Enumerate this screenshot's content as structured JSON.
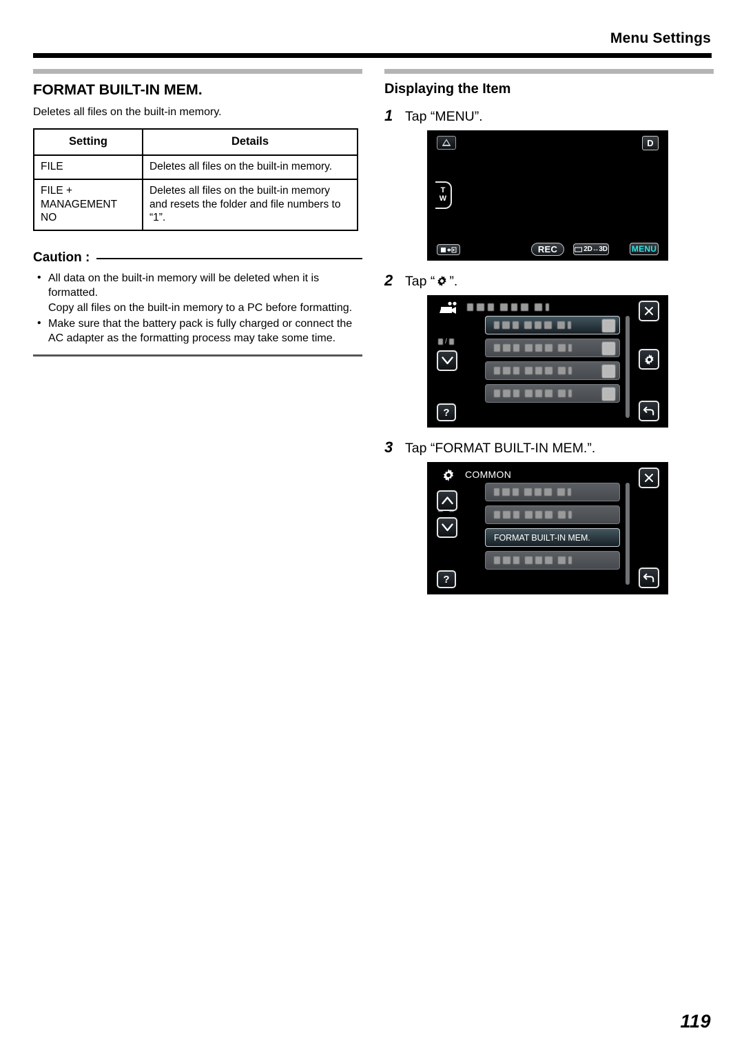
{
  "header": {
    "title": "Menu Settings"
  },
  "left_column": {
    "section_title": "FORMAT BUILT-IN MEM.",
    "lead": "Deletes all files on the built-in memory.",
    "table": {
      "headers": [
        "Setting",
        "Details"
      ],
      "rows": [
        [
          "FILE",
          "Deletes all files on the built-in memory."
        ],
        [
          "FILE + MANAGEMENT NO",
          "Deletes all files on the built-in memory and resets the folder and file numbers to “1”."
        ]
      ]
    },
    "caution": {
      "label": "Caution :",
      "items": [
        "All data on the built-in memory will be deleted when it is formatted.\nCopy all files on the built-in memory to a PC before formatting.",
        "Make sure that the battery pack is fully charged or connect the AC adapter as the formatting process may take some time."
      ]
    }
  },
  "right_column": {
    "section_title": "Displaying the Item",
    "steps": [
      {
        "number": "1",
        "text_before": "Tap “MENU”.",
        "text_after": ""
      },
      {
        "number": "2",
        "text_before": "Tap “",
        "text_after": "”."
      },
      {
        "number": "3",
        "text_before": "Tap “FORMAT BUILT-IN MEM.”.",
        "text_after": ""
      }
    ],
    "screen_rec": {
      "icons": {
        "tripod": "tripod-icon",
        "d_badge": "D",
        "zoom_top": "T",
        "zoom_bottom": "W",
        "playmode": "play-record-switch-icon",
        "rec": "REC",
        "mode_2d3d": "2D↔3D",
        "menu": "MENU"
      },
      "menu_button_color": "#29e6e6"
    },
    "screen_menu_1": {
      "top_icon": "camcorder-icon",
      "title_redacted": true,
      "page_indicator": "■/■",
      "rows": [
        {
          "label": "",
          "redacted": true,
          "selected": true,
          "thumb": true
        },
        {
          "label": "",
          "redacted": true,
          "selected": false,
          "thumb": true
        },
        {
          "label": "",
          "redacted": true,
          "selected": false,
          "thumb": true
        },
        {
          "label": "",
          "redacted": true,
          "selected": false,
          "thumb": true
        }
      ],
      "buttons": {
        "close": "✕",
        "gear": "gear-icon",
        "back": "back-arrow-icon",
        "down": "∨",
        "help": "?"
      }
    },
    "screen_menu_2": {
      "top_icon": "gear-icon",
      "title": "COMMON",
      "page_indicator": "■/■",
      "rows": [
        {
          "label": "",
          "redacted": true,
          "selected": false,
          "thumb": false
        },
        {
          "label": "",
          "redacted": true,
          "selected": false,
          "thumb": false
        },
        {
          "label": "FORMAT BUILT-IN MEM.",
          "redacted": false,
          "selected": true,
          "thumb": false
        },
        {
          "label": "",
          "redacted": true,
          "selected": false,
          "thumb": false
        }
      ],
      "buttons": {
        "close": "✕",
        "back": "back-arrow-icon",
        "up": "∧",
        "down": "∨",
        "help": "?"
      }
    }
  },
  "footer": {
    "page_number": "119"
  }
}
